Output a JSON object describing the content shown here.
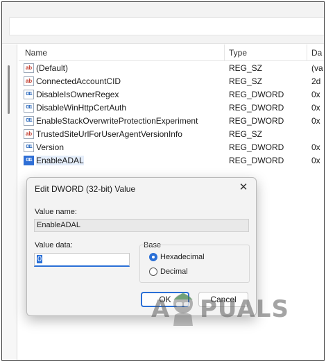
{
  "columns": {
    "name": "Name",
    "type": "Type",
    "data": "Da"
  },
  "values": [
    {
      "icon": "string-value-icon",
      "kind": "sz",
      "name": "(Default)",
      "type": "REG_SZ",
      "data": "(va",
      "selected": false
    },
    {
      "icon": "string-value-icon",
      "kind": "sz",
      "name": "ConnectedAccountCID",
      "type": "REG_SZ",
      "data": "2d",
      "selected": false
    },
    {
      "icon": "binary-value-icon",
      "kind": "bin",
      "name": "DisableIsOwnerRegex",
      "type": "REG_DWORD",
      "data": "0x",
      "selected": false
    },
    {
      "icon": "binary-value-icon",
      "kind": "bin",
      "name": "DisableWinHttpCertAuth",
      "type": "REG_DWORD",
      "data": "0x",
      "selected": false
    },
    {
      "icon": "binary-value-icon",
      "kind": "bin",
      "name": "EnableStackOverwriteProtectionExperiment",
      "type": "REG_DWORD",
      "data": "0x",
      "selected": false
    },
    {
      "icon": "string-value-icon",
      "kind": "sz",
      "name": "TrustedSiteUrlForUserAgentVersionInfo",
      "type": "REG_SZ",
      "data": "",
      "selected": false
    },
    {
      "icon": "binary-value-icon",
      "kind": "bin",
      "name": "Version",
      "type": "REG_DWORD",
      "data": "0x",
      "selected": false
    },
    {
      "icon": "binary-value-icon",
      "kind": "bin",
      "name": "EnableADAL",
      "type": "REG_DWORD",
      "data": "0x",
      "selected": true
    }
  ],
  "dialog": {
    "title": "Edit DWORD (32-bit) Value",
    "close_glyph": "✕",
    "value_name_label": "Value name:",
    "value_name": "EnableADAL",
    "value_data_label": "Value data:",
    "value_data": "0",
    "base_label": "Base",
    "hex_label": "Hexadecimal",
    "dec_label": "Decimal",
    "base_selected": "Hexadecimal",
    "ok_label": "OK",
    "cancel_label": "Cancel"
  },
  "watermark": {
    "text_left": "A",
    "text_right": "PUALS"
  },
  "colors": {
    "accent": "#2a6fd6",
    "string_icon": "#c0392b",
    "dword_icon": "#1d5fb8"
  }
}
